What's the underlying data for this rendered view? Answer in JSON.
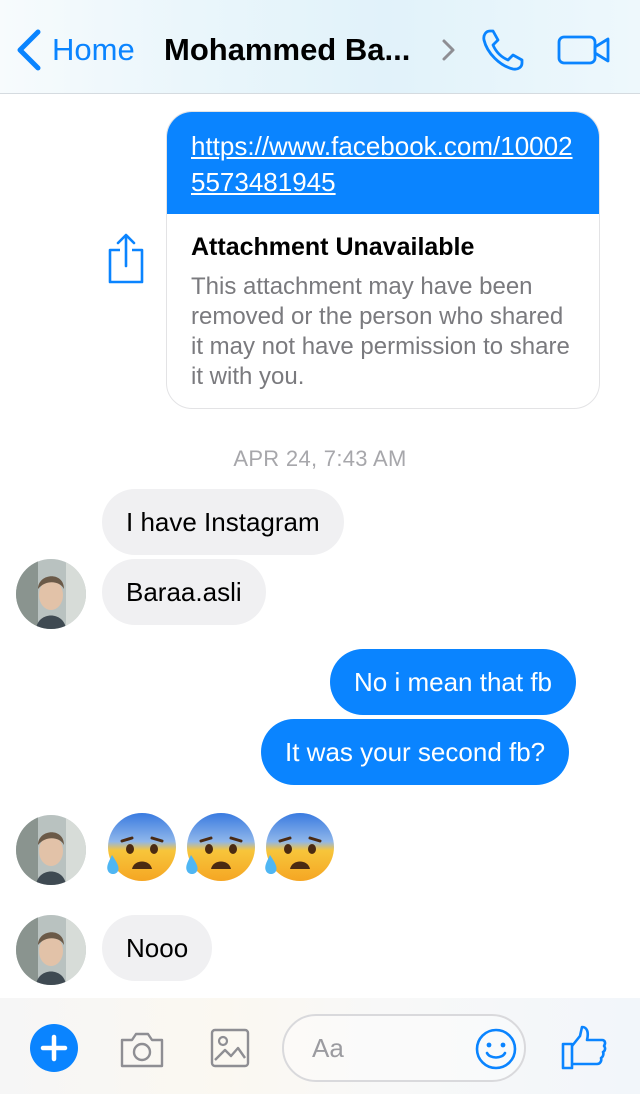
{
  "header": {
    "back_label": "Home",
    "title": "Mohammed Ba...",
    "accent": "#0a84ff"
  },
  "messages": {
    "attachment": {
      "link": "https://www.facebook.com/100025573481945",
      "title": "Attachment Unavailable",
      "description": "This attachment may have been removed or the person who shared it may not have permission to share it with you."
    },
    "timestamp": "APR 24, 7:43 AM",
    "incoming_1": "I have Instagram",
    "incoming_2": "Baraa.asli",
    "outgoing_1": "No i mean that fb",
    "outgoing_2": "It was your second fb?",
    "emoji_count": 3,
    "emoji_icon": "anxious-face-with-sweat-icon",
    "incoming_3": "Nooo"
  },
  "composer": {
    "placeholder": "Aa",
    "icons": [
      "plus-icon",
      "camera-icon",
      "gallery-icon",
      "emoji-icon",
      "thumbs-up-icon"
    ]
  },
  "colors": {
    "outgoing_bubble": "#0a84ff",
    "incoming_bubble": "#f0f0f2"
  }
}
